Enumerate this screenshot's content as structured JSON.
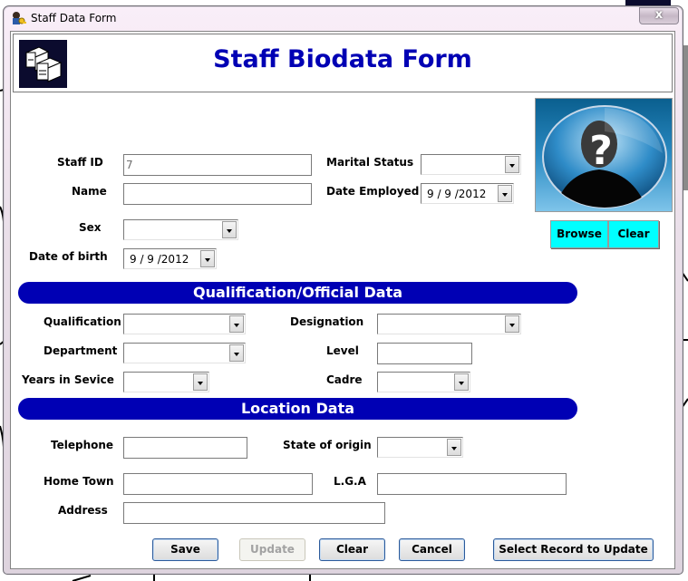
{
  "window": {
    "title": "Staff Data Form",
    "close_label": "x"
  },
  "header": {
    "title": "Staff Biodata Form",
    "logo_icon": "computer-network-icon"
  },
  "photo": {
    "placeholder_icon": "unknown-person-icon",
    "browse_label": "Browse",
    "clear_label": "Clear"
  },
  "personal": {
    "staff_id": {
      "label": "Staff ID",
      "value": "7"
    },
    "name": {
      "label": "Name",
      "value": ""
    },
    "sex": {
      "label": "Sex",
      "value": ""
    },
    "date_of_birth": {
      "label": "Date of birth",
      "value": "9 / 9 /2012"
    },
    "marital_status": {
      "label": "Marital Status",
      "value": ""
    },
    "date_employed": {
      "label": "Date Employed",
      "value": "9 / 9 /2012"
    }
  },
  "sections": {
    "qualification_title": "Qualification/Official Data",
    "location_title": "Location Data"
  },
  "official": {
    "qualification": {
      "label": "Qualification",
      "value": ""
    },
    "department": {
      "label": "Department",
      "value": ""
    },
    "years_in_service": {
      "label": "Years in Sevice",
      "value": ""
    },
    "designation": {
      "label": "Designation",
      "value": ""
    },
    "level": {
      "label": "Level",
      "value": ""
    },
    "cadre": {
      "label": "Cadre",
      "value": ""
    }
  },
  "location": {
    "telephone": {
      "label": "Telephone",
      "value": ""
    },
    "state_of_origin": {
      "label": "State of origin",
      "value": ""
    },
    "home_town": {
      "label": "Home Town",
      "value": ""
    },
    "lga": {
      "label": "L.G.A",
      "value": ""
    },
    "address": {
      "label": "Address",
      "value": ""
    }
  },
  "actions": {
    "save": "Save",
    "update": "Update",
    "clear": "Clear",
    "cancel": "Cancel",
    "select_record": "Select Record to Update"
  },
  "colors": {
    "accent": "#0000b4",
    "photo_button": "#00ffff"
  }
}
